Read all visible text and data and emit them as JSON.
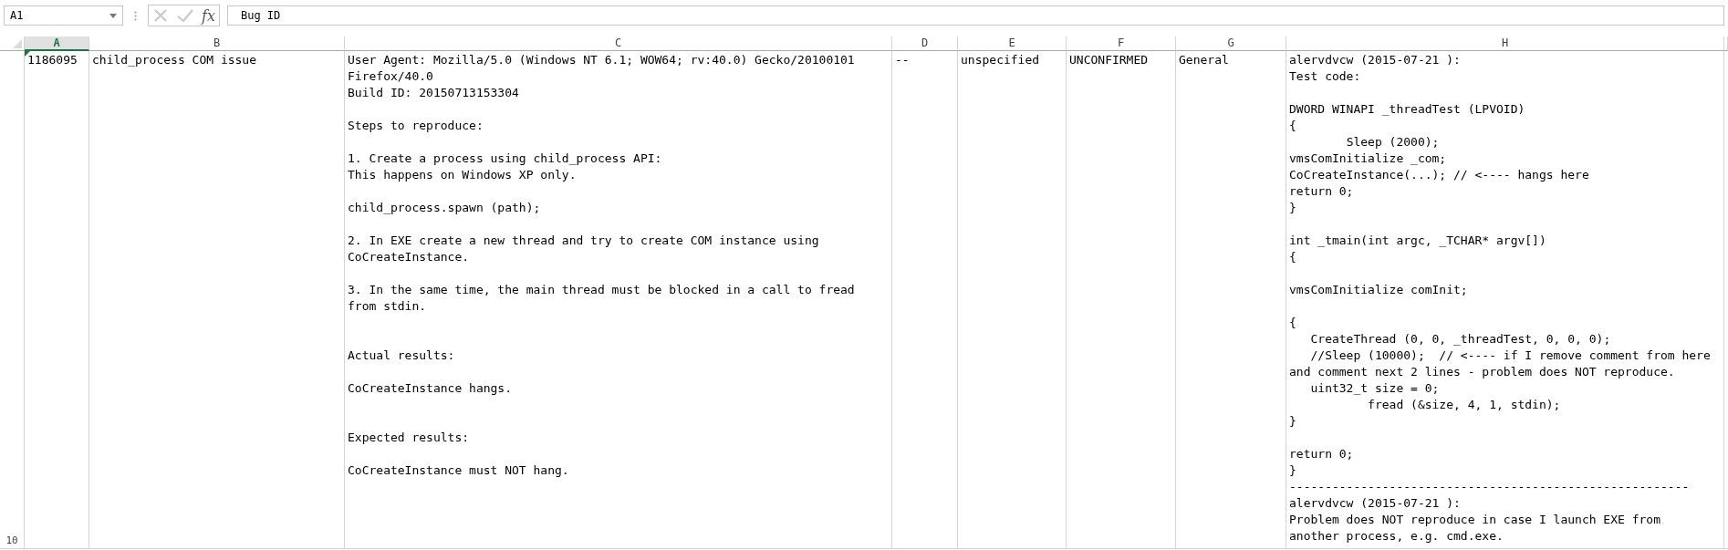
{
  "name_box": {
    "value": "A1"
  },
  "formula_bar": {
    "cancel_button": {
      "disabled": true
    },
    "enter_button": {
      "disabled": true
    },
    "function_button": "fx",
    "formula": "Bug ID"
  },
  "columns": [
    {
      "label": "A",
      "selected": true
    },
    {
      "label": "B",
      "selected": false
    },
    {
      "label": "C",
      "selected": false
    },
    {
      "label": "D",
      "selected": false
    },
    {
      "label": "E",
      "selected": false
    },
    {
      "label": "F",
      "selected": false
    },
    {
      "label": "G",
      "selected": false
    },
    {
      "label": "H",
      "selected": false
    }
  ],
  "row": {
    "number": "10",
    "cells": [
      {
        "text": "1186095",
        "flagged": true
      },
      {
        "text": "child_process COM issue",
        "flagged": false
      },
      {
        "text": "User Agent: Mozilla/5.0 (Windows NT 6.1; WOW64; rv:40.0) Gecko/20100101\nFirefox/40.0\nBuild ID: 20150713153304\n\nSteps to reproduce:\n\n1. Create a process using child_process API:\nThis happens on Windows XP only.\n\nchild_process.spawn (path);\n\n2. In EXE create a new thread and try to create COM instance using\nCoCreateInstance.\n\n3. In the same time, the main thread must be blocked in a call to fread\nfrom stdin.\n\n\nActual results:\n\nCoCreateInstance hangs.\n\n\nExpected results:\n\nCoCreateInstance must NOT hang.",
        "flagged": false
      },
      {
        "text": "--",
        "flagged": false
      },
      {
        "text": "unspecified",
        "flagged": false
      },
      {
        "text": "UNCONFIRMED",
        "flagged": false
      },
      {
        "text": "General",
        "flagged": false
      },
      {
        "text": "alervdvcw (2015-07-21 ):\nTest code:\n\nDWORD WINAPI _threadTest (LPVOID)\n{\n        Sleep (2000);\nvmsComInitialize _com;\nCoCreateInstance(...); // <---- hangs here\nreturn 0;\n}\n\nint _tmain(int argc, _TCHAR* argv[])\n{\n\nvmsComInitialize comInit;\n\n{\n   CreateThread (0, 0, _threadTest, 0, 0, 0);\n   //Sleep (10000);  // <---- if I remove comment from here and comment next 2 lines - problem does NOT reproduce.\n   uint32_t size = 0;\n           fread (&size, 4, 1, stdin);\n}\n\nreturn 0;\n}\n--------------------------------------------------------\nalervdvcw (2015-07-21 ):\nProblem does NOT reproduce in case I launch EXE from\nanother process, e.g. cmd.exe.",
        "flagged": false
      }
    ]
  }
}
